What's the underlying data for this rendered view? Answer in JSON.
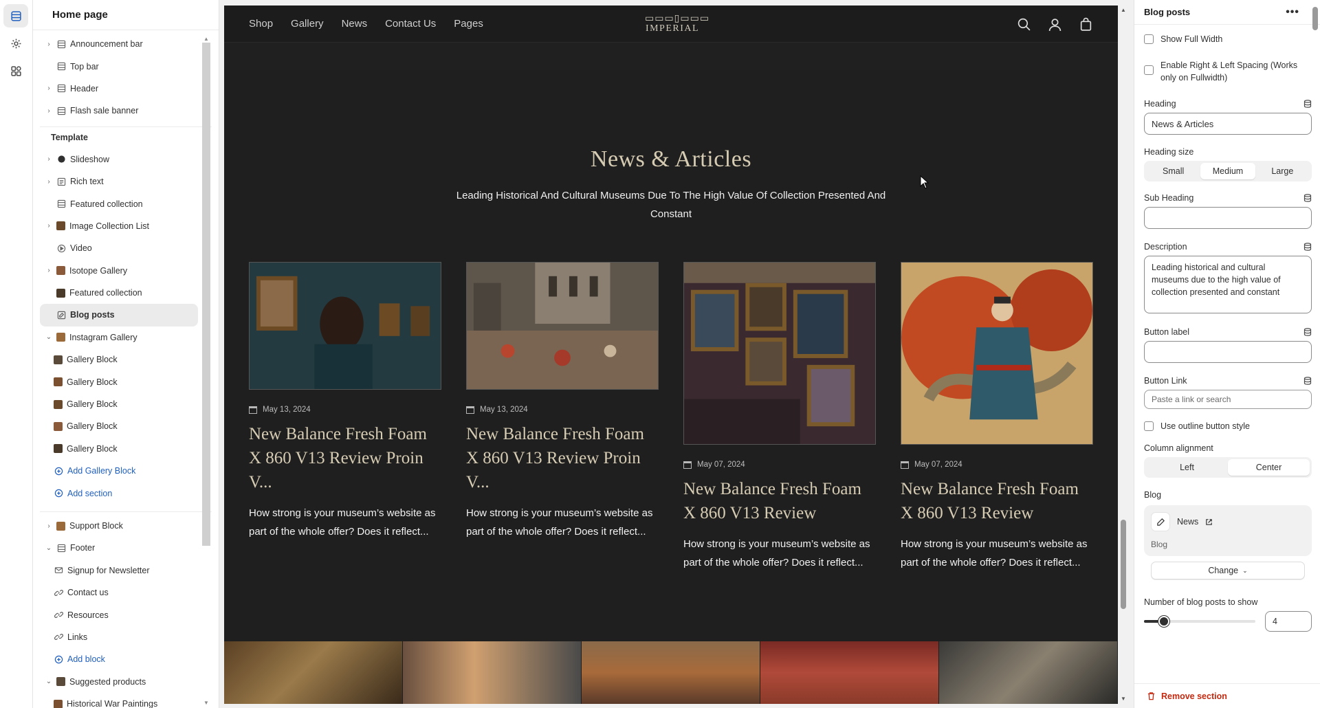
{
  "rail": {
    "items": [
      "sections-icon",
      "gear-icon",
      "apps-icon"
    ]
  },
  "sidebar": {
    "title": "Home page",
    "header_group": [
      {
        "label": "Announcement bar",
        "icon": "section-icon",
        "expandable": true
      },
      {
        "label": "Top bar",
        "icon": "section-icon",
        "expandable": false
      },
      {
        "label": "Header",
        "icon": "section-icon",
        "expandable": true
      },
      {
        "label": "Flash sale banner",
        "icon": "section-icon",
        "expandable": true
      }
    ],
    "template_title": "Template",
    "template": [
      {
        "label": "Slideshow",
        "icon": "circle-icon",
        "expandable": true
      },
      {
        "label": "Rich text",
        "icon": "text-icon",
        "expandable": true
      },
      {
        "label": "Featured collection",
        "icon": "section-icon",
        "expandable": false
      },
      {
        "label": "Image Collection List",
        "icon": "image-thumb",
        "expandable": true
      },
      {
        "label": "Video",
        "icon": "play-icon",
        "expandable": false
      },
      {
        "label": "Isotope Gallery",
        "icon": "image-thumb",
        "expandable": true
      },
      {
        "label": "Featured collection",
        "icon": "image-thumb",
        "expandable": false
      },
      {
        "label": "Blog posts",
        "icon": "edit-icon",
        "expandable": false,
        "selected": true
      },
      {
        "label": "Instagram Gallery",
        "icon": "image-thumb",
        "expandable": true,
        "open": true
      }
    ],
    "instagram_children": [
      "Gallery Block",
      "Gallery Block",
      "Gallery Block",
      "Gallery Block",
      "Gallery Block"
    ],
    "add_gallery_block": "Add Gallery Block",
    "add_section": "Add section",
    "footer_group": [
      {
        "label": "Support Block",
        "icon": "image-thumb",
        "expandable": true
      },
      {
        "label": "Footer",
        "icon": "section-icon",
        "expandable": true,
        "open": true
      }
    ],
    "footer_children": [
      {
        "label": "Signup for Newsletter",
        "icon": "mail-icon"
      },
      {
        "label": "Contact us",
        "icon": "link-icon"
      },
      {
        "label": "Resources",
        "icon": "link-icon"
      },
      {
        "label": "Links",
        "icon": "link-icon"
      }
    ],
    "add_block": "Add block",
    "suggested": {
      "label": "Suggested products",
      "icon": "image-thumb"
    },
    "suggested_children": [
      "Historical War Paintings"
    ]
  },
  "preview": {
    "nav": [
      "Shop",
      "Gallery",
      "News",
      "Contact Us",
      "Pages"
    ],
    "logo_text": "IMPERIAL",
    "heading": "News & Articles",
    "subheading": "Leading Historical And Cultural Museums Due To The High Value Of Collection Presented And Constant",
    "posts": [
      {
        "date": "May 13, 2024",
        "title": "New Balance Fresh Foam X 860 V13 Review Proin V...",
        "excerpt": "How strong is your museum’s website as part of the whole offer? Does it reflect..."
      },
      {
        "date": "May 13, 2024",
        "title": "New Balance Fresh Foam X 860 V13 Review Proin V...",
        "excerpt": "How strong is your museum’s website as part of the whole offer? Does it reflect..."
      },
      {
        "date": "May 07, 2024",
        "title": "New Balance Fresh Foam X 860 V13 Review",
        "excerpt": "How strong is your museum’s website as part of the whole offer? Does it reflect..."
      },
      {
        "date": "May 07, 2024",
        "title": "New Balance Fresh Foam X 860 V13 Review",
        "excerpt": "How strong is your museum’s website as part of the whole offer? Does it reflect..."
      }
    ]
  },
  "panel": {
    "title": "Blog posts",
    "show_full_width": "Show Full Width",
    "enable_spacing": "Enable Right & Left Spacing (Works only on Fullwidth)",
    "heading_label": "Heading",
    "heading_value": "News & Articles",
    "heading_size_label": "Heading size",
    "heading_sizes": [
      "Small",
      "Medium",
      "Large"
    ],
    "heading_size_selected": "Medium",
    "sub_heading_label": "Sub Heading",
    "sub_heading_value": "",
    "description_label": "Description",
    "description_value": "Leading historical and cultural museums due to the high value of collection presented and constant",
    "button_label_label": "Button label",
    "button_label_value": "",
    "button_link_label": "Button Link",
    "button_link_placeholder": "Paste a link or search",
    "outline_label": "Use outline button style",
    "column_alignment_label": "Column alignment",
    "alignments": [
      "Left",
      "Center"
    ],
    "alignment_selected": "Center",
    "blog_label": "Blog",
    "blog_name": "News",
    "blog_sub": "Blog",
    "change_label": "Change",
    "posts_count_label": "Number of blog posts to show",
    "posts_count": "4",
    "posts_count_fraction": 0.18,
    "remove_label": "Remove section"
  },
  "colors": {
    "accent": "#1f5fbf",
    "danger": "#c4290f",
    "preview_bg": "#1f1f1f",
    "heading_gold": "#d6cbb3"
  }
}
